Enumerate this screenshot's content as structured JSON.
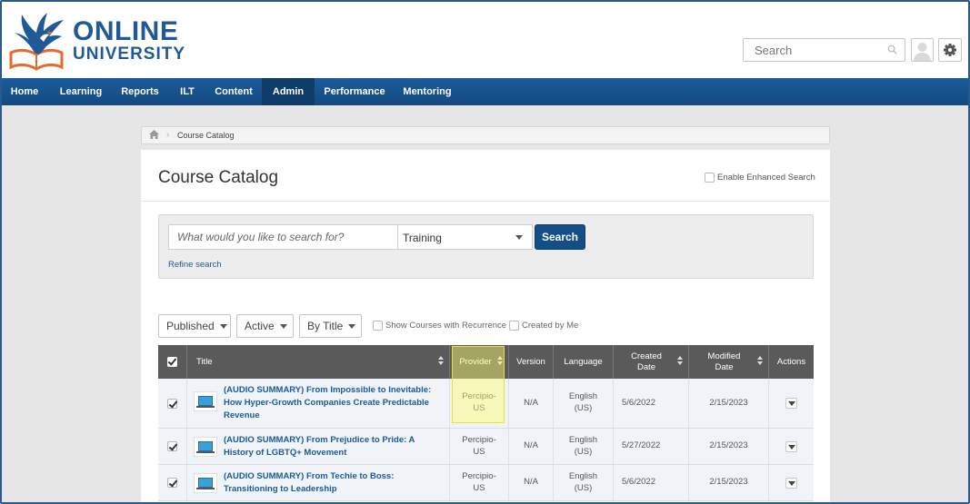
{
  "brand": {
    "line1": "ONLINE",
    "line2": "UNIVERSITY",
    "color": "#1f5a96"
  },
  "header": {
    "search_placeholder": "Search"
  },
  "nav": {
    "items": [
      "Home",
      "Learning",
      "Reports",
      "ILT",
      "Content",
      "Admin",
      "Performance",
      "Mentoring"
    ],
    "active": "Admin"
  },
  "breadcrumb": {
    "current": "Course Catalog"
  },
  "page": {
    "title": "Course Catalog",
    "enhanced_search_label": "Enable Enhanced Search"
  },
  "search": {
    "placeholder": "What would you like to search for?",
    "type_selected": "Training",
    "button_label": "Search",
    "refine_label": "Refine search"
  },
  "filters": {
    "published": "Published",
    "active": "Active",
    "sort": "By Title",
    "show_recurrence": "Show Courses with Recurrence",
    "created_by_me": "Created by Me"
  },
  "table": {
    "headers": {
      "title": "Title",
      "provider": "Provider",
      "version": "Version",
      "language": "Language",
      "created_line1": "Created",
      "created_line2": "Date",
      "modified_line1": "Modified",
      "modified_line2": "Date",
      "actions": "Actions"
    },
    "rows": [
      {
        "title": "(AUDIO SUMMARY) From Impossible to Inevitable: How Hyper-Growth Companies Create Predictable Revenue",
        "provider": "Percipio-US",
        "version": "N/A",
        "language": "English (US)",
        "created": "5/6/2022",
        "modified": "2/15/2023"
      },
      {
        "title": "(AUDIO SUMMARY) From Prejudice to Pride: A History of LGBTQ+ Movement",
        "provider": "Percipio-US",
        "version": "N/A",
        "language": "English (US)",
        "created": "5/27/2022",
        "modified": "2/15/2023"
      },
      {
        "title": "(AUDIO SUMMARY) From Techie to Boss: Transitioning to Leadership",
        "provider": "Percipio-US",
        "version": "N/A",
        "language": "English (US)",
        "created": "5/6/2022",
        "modified": "2/15/2023"
      }
    ]
  }
}
